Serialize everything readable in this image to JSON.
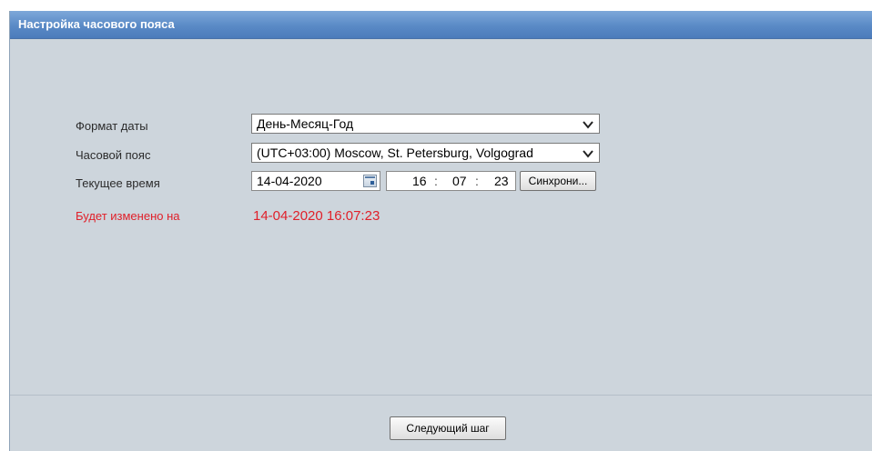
{
  "window": {
    "title": "Настройка часового пояса"
  },
  "form": {
    "date_format": {
      "label": "Формат даты",
      "value": "День-Месяц-Год"
    },
    "timezone": {
      "label": "Часовой пояс",
      "value": "(UTC+03:00) Moscow, St. Petersburg, Volgograd"
    },
    "current_time": {
      "label": "Текущее время",
      "date": "14-04-2020",
      "hour": "16",
      "minute": "07",
      "second": "23",
      "sync_label": "Синхрони..."
    },
    "will_change": {
      "label": "Будет изменено на",
      "value": "14-04-2020 16:07:23"
    }
  },
  "footer": {
    "next_label": "Следующий шаг"
  },
  "icons": [
    "chevron-down-icon",
    "calendar-icon"
  ],
  "colors": {
    "title_bar": "#5a8ac6",
    "panel_bg": "#cdd5dc",
    "alert": "#e0202a"
  }
}
